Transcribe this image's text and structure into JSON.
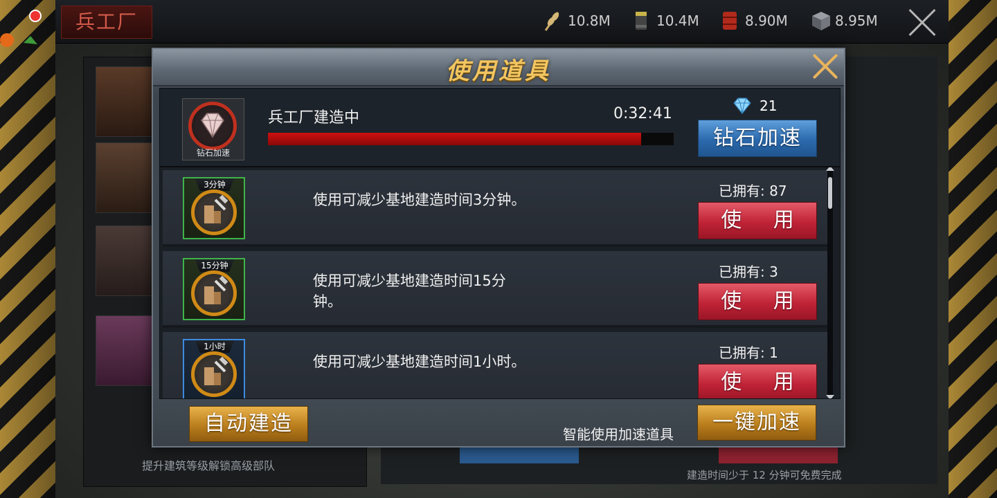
{
  "header": {
    "factory_title": "兵工厂",
    "resources": [
      {
        "icon": "wheat-icon",
        "value": "10.8M"
      },
      {
        "icon": "oil-barrel-icon",
        "value": "10.4M"
      },
      {
        "icon": "fuel-drum-icon",
        "value": "8.90M"
      },
      {
        "icon": "steel-cube-icon",
        "value": "8.95M"
      }
    ]
  },
  "background": {
    "hint_left": "提升建筑等级解锁高级部队",
    "hint_right": "建造时间少于 12 分钟可免费完成"
  },
  "dialog": {
    "title": "使用道具",
    "build": {
      "icon_label": "钻石加速",
      "name": "兵工厂建造中",
      "time": "0:32:41",
      "progress": 0.92,
      "gem_cost": "21",
      "gem_button": "钻石加速"
    },
    "items": [
      {
        "tag": "3分钟",
        "desc": "使用可减少基地建造时间3分钟。",
        "owned": "已拥有: 87",
        "button": "使 用",
        "frame": "green"
      },
      {
        "tag": "15分钟",
        "desc": "使用可减少基地建造时间15分钟。",
        "owned": "已拥有: 3",
        "button": "使 用",
        "frame": "green"
      },
      {
        "tag": "1小时",
        "desc": "使用可减少基地建造时间1小时。",
        "owned": "已拥有: 1",
        "button": "使 用",
        "frame": "blue"
      }
    ],
    "footer": {
      "auto_build": "自动建造",
      "smart_label": "智能使用加速道具",
      "quick_speed": "一键加速"
    }
  },
  "colors": {
    "accent_gold": "#f2c560",
    "progress_red": "#cf1010",
    "button_blue": "#2b69ad",
    "button_red": "#c02336",
    "button_gold": "#b67a1a"
  }
}
